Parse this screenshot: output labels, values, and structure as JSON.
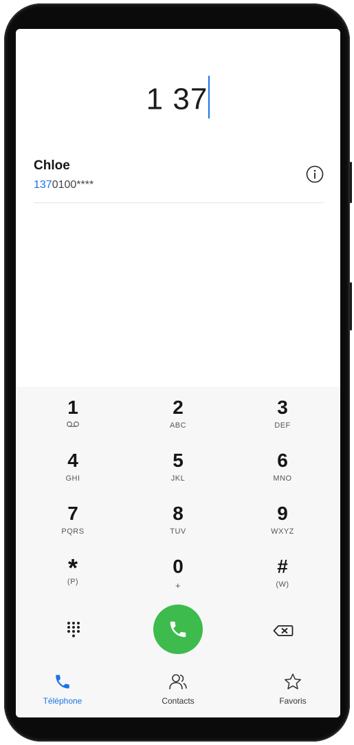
{
  "dialer": {
    "typed_number": "1 37"
  },
  "suggestion": {
    "name": "Chloe",
    "number_match": "137",
    "number_rest": "0100****"
  },
  "keypad": {
    "keys": [
      {
        "digit": "1",
        "letters": ""
      },
      {
        "digit": "2",
        "letters": "ABC"
      },
      {
        "digit": "3",
        "letters": "DEF"
      },
      {
        "digit": "4",
        "letters": "GHI"
      },
      {
        "digit": "5",
        "letters": "JKL"
      },
      {
        "digit": "6",
        "letters": "MNO"
      },
      {
        "digit": "7",
        "letters": "PQRS"
      },
      {
        "digit": "8",
        "letters": "TUV"
      },
      {
        "digit": "9",
        "letters": "WXYZ"
      },
      {
        "digit": "*",
        "letters": "(P)"
      },
      {
        "digit": "0",
        "letters": "+"
      },
      {
        "digit": "#",
        "letters": "(W)"
      }
    ]
  },
  "tabs": [
    {
      "label": "Téléphone",
      "active": true
    },
    {
      "label": "Contacts",
      "active": false
    },
    {
      "label": "Favoris",
      "active": false
    }
  ],
  "colors": {
    "accent": "#1a73e8",
    "call_green": "#3dbb4c"
  },
  "icons": [
    "info-icon",
    "voicemail-icon",
    "dialpad-icon",
    "phone-call-icon",
    "backspace-icon",
    "phone-icon",
    "contacts-icon",
    "star-icon"
  ]
}
